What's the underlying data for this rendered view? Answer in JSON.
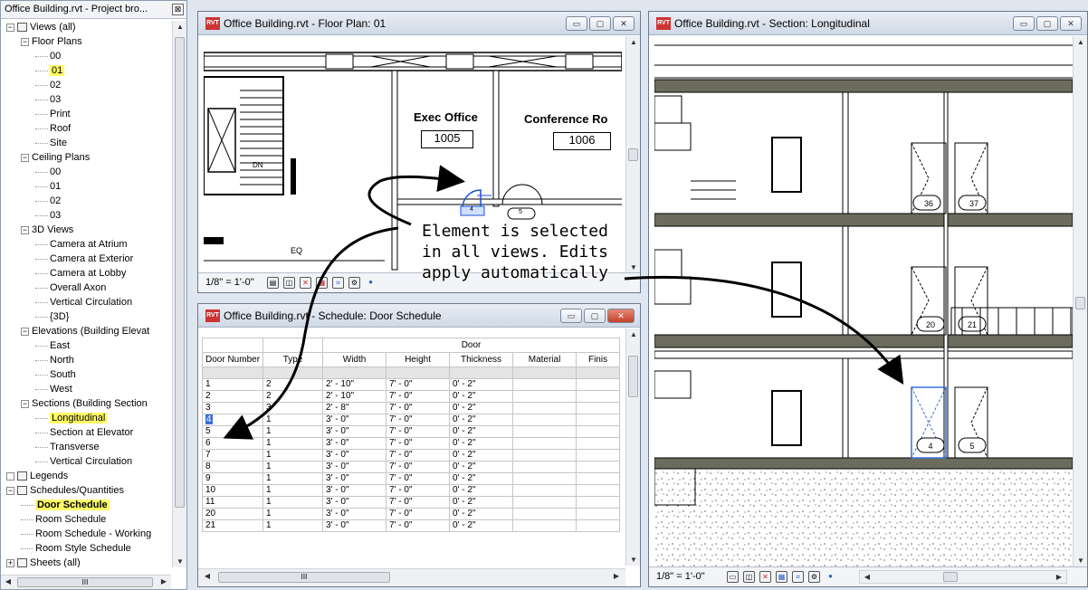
{
  "project_browser": {
    "title": "Office Building.rvt - Project bro...",
    "close_glyph": "⊠",
    "tree": [
      {
        "label": "Views (all)",
        "level": 0,
        "toggle": "−",
        "icon": "views-icon"
      },
      {
        "label": "Floor Plans",
        "level": 1,
        "toggle": "−"
      },
      {
        "label": "00",
        "level": 2
      },
      {
        "label": "01",
        "level": 2,
        "highlight": true
      },
      {
        "label": "02",
        "level": 2
      },
      {
        "label": "03",
        "level": 2
      },
      {
        "label": "Print",
        "level": 2
      },
      {
        "label": "Roof",
        "level": 2
      },
      {
        "label": "Site",
        "level": 2
      },
      {
        "label": "Ceiling Plans",
        "level": 1,
        "toggle": "−"
      },
      {
        "label": "00",
        "level": 2
      },
      {
        "label": "01",
        "level": 2
      },
      {
        "label": "02",
        "level": 2
      },
      {
        "label": "03",
        "level": 2
      },
      {
        "label": "3D Views",
        "level": 1,
        "toggle": "−"
      },
      {
        "label": "Camera at Atrium",
        "level": 2
      },
      {
        "label": "Camera at Exterior",
        "level": 2
      },
      {
        "label": "Camera at Lobby",
        "level": 2
      },
      {
        "label": "Overall Axon",
        "level": 2
      },
      {
        "label": "Vertical Circulation",
        "level": 2
      },
      {
        "label": "{3D}",
        "level": 2
      },
      {
        "label": "Elevations (Building Elevat",
        "level": 1,
        "toggle": "−"
      },
      {
        "label": "East",
        "level": 2
      },
      {
        "label": "North",
        "level": 2
      },
      {
        "label": "South",
        "level": 2
      },
      {
        "label": "West",
        "level": 2
      },
      {
        "label": "Sections (Building Section",
        "level": 1,
        "toggle": "−"
      },
      {
        "label": "Longitudinal",
        "level": 2,
        "highlight": true
      },
      {
        "label": "Section at Elevator",
        "level": 2
      },
      {
        "label": "Transverse",
        "level": 2
      },
      {
        "label": "Vertical Circulation",
        "level": 2
      },
      {
        "label": "Legends",
        "level": 0,
        "toggle": "",
        "icon": "legends-icon"
      },
      {
        "label": "Schedules/Quantities",
        "level": 0,
        "toggle": "−",
        "icon": "schedules-icon"
      },
      {
        "label": "Door Schedule",
        "level": 1,
        "highlight": true,
        "bold": true
      },
      {
        "label": "Room Schedule",
        "level": 1
      },
      {
        "label": "Room Schedule - Working",
        "level": 1
      },
      {
        "label": "Room Style Schedule",
        "level": 1
      },
      {
        "label": "Sheets (all)",
        "level": 0,
        "toggle": "+",
        "icon": "sheets-icon"
      }
    ],
    "hscroll_mid": "III"
  },
  "floor_plan": {
    "title": "Office Building.rvt - Floor Plan: 01",
    "rooms": [
      {
        "name": "Exec Office",
        "number": "1005"
      },
      {
        "name": "Conference Ro",
        "number": "1006"
      }
    ],
    "labels": {
      "dn": "DN",
      "eq": "EQ",
      "door4": "4",
      "door5": "5"
    },
    "scale": "1/8\" = 1'-0\""
  },
  "schedule": {
    "title": "Office Building.rvt - Schedule: Door Schedule",
    "group_header": "Door",
    "columns": [
      "Door Number",
      "Type",
      "Width",
      "Height",
      "Thickness",
      "Material",
      "Finis"
    ],
    "rows": [
      [
        "1",
        "2",
        "2' - 10\"",
        "7' - 0\"",
        "0' - 2\"",
        "",
        ""
      ],
      [
        "2",
        "2",
        "2' - 10\"",
        "7' - 0\"",
        "0' - 2\"",
        "",
        ""
      ],
      [
        "3",
        "3",
        "2' - 8\"",
        "7' - 0\"",
        "0' - 2\"",
        "",
        ""
      ],
      [
        "4",
        "1",
        "3' - 0\"",
        "7' - 0\"",
        "0' - 2\"",
        "",
        ""
      ],
      [
        "5",
        "1",
        "3' - 0\"",
        "7' - 0\"",
        "0' - 2\"",
        "",
        ""
      ],
      [
        "6",
        "1",
        "3' - 0\"",
        "7' - 0\"",
        "0' - 2\"",
        "",
        ""
      ],
      [
        "7",
        "1",
        "3' - 0\"",
        "7' - 0\"",
        "0' - 2\"",
        "",
        ""
      ],
      [
        "8",
        "1",
        "3' - 0\"",
        "7' - 0\"",
        "0' - 2\"",
        "",
        ""
      ],
      [
        "9",
        "1",
        "3' - 0\"",
        "7' - 0\"",
        "0' - 2\"",
        "",
        ""
      ],
      [
        "10",
        "1",
        "3' - 0\"",
        "7' - 0\"",
        "0' - 2\"",
        "",
        ""
      ],
      [
        "11",
        "1",
        "3' - 0\"",
        "7' - 0\"",
        "0' - 2\"",
        "",
        ""
      ],
      [
        "20",
        "1",
        "3' - 0\"",
        "7' - 0\"",
        "0' - 2\"",
        "",
        ""
      ],
      [
        "21",
        "1",
        "3' - 0\"",
        "7' - 0\"",
        "0' - 2\"",
        "",
        ""
      ]
    ],
    "hscroll_mid": "III"
  },
  "section": {
    "title": "Office Building.rvt - Section: Longitudinal",
    "door_tags": [
      "36",
      "37",
      "20",
      "21",
      "4",
      "5"
    ],
    "scale": "1/8\" = 1'-0\""
  },
  "callout": {
    "lines": [
      "Element is selected",
      "in all views. Edits",
      "apply automatically"
    ]
  },
  "window_buttons": {
    "minimize": "▭",
    "maximize": "▢",
    "close": "✕"
  },
  "colors": {
    "highlight": "#fffb66",
    "selection": "#3a6fd6",
    "floor_band": "#6b6b5e"
  }
}
